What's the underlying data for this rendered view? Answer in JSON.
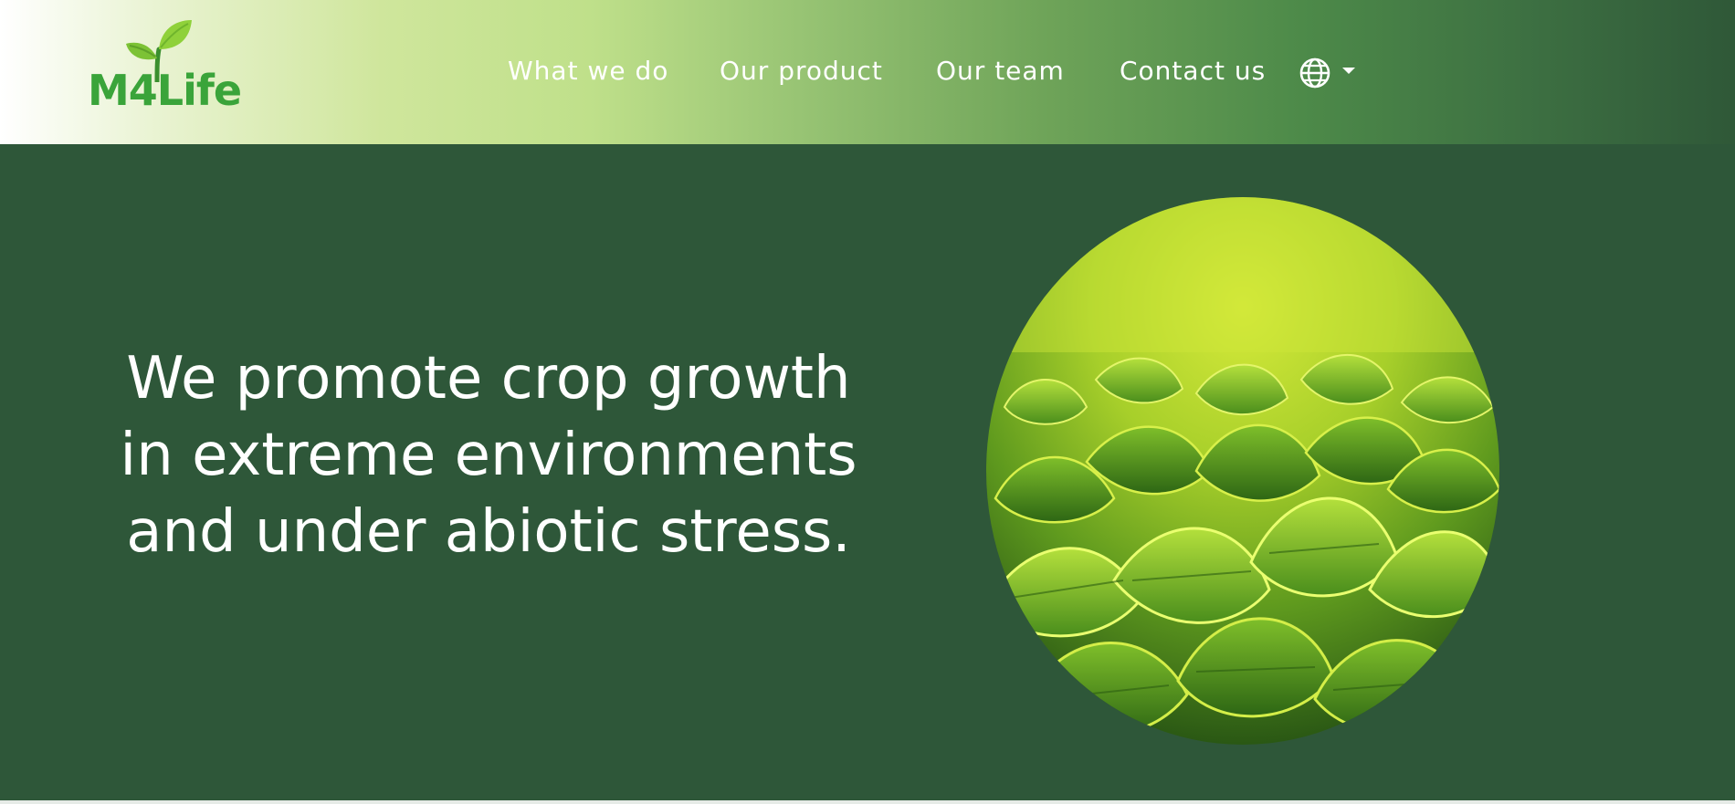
{
  "brand": {
    "logo_text": "M4Life",
    "logo_color": "#3aa43a",
    "sprout_color": "#8fd13a"
  },
  "nav": {
    "items": [
      {
        "label": "What we do"
      },
      {
        "label": "Our product"
      },
      {
        "label": "Our team"
      },
      {
        "label": "Contact us"
      }
    ],
    "language_icon": "globe-icon"
  },
  "hero": {
    "headline": "We promote crop growth in extreme environments and under abiotic stress.",
    "image_subject": "green-crop-leaves"
  },
  "colors": {
    "background": "#2e5739",
    "text": "#ffffff",
    "header_gradient_start": "#ffffff",
    "header_gradient_mid": "#bfe08a",
    "header_gradient_end": "#2f5838"
  }
}
